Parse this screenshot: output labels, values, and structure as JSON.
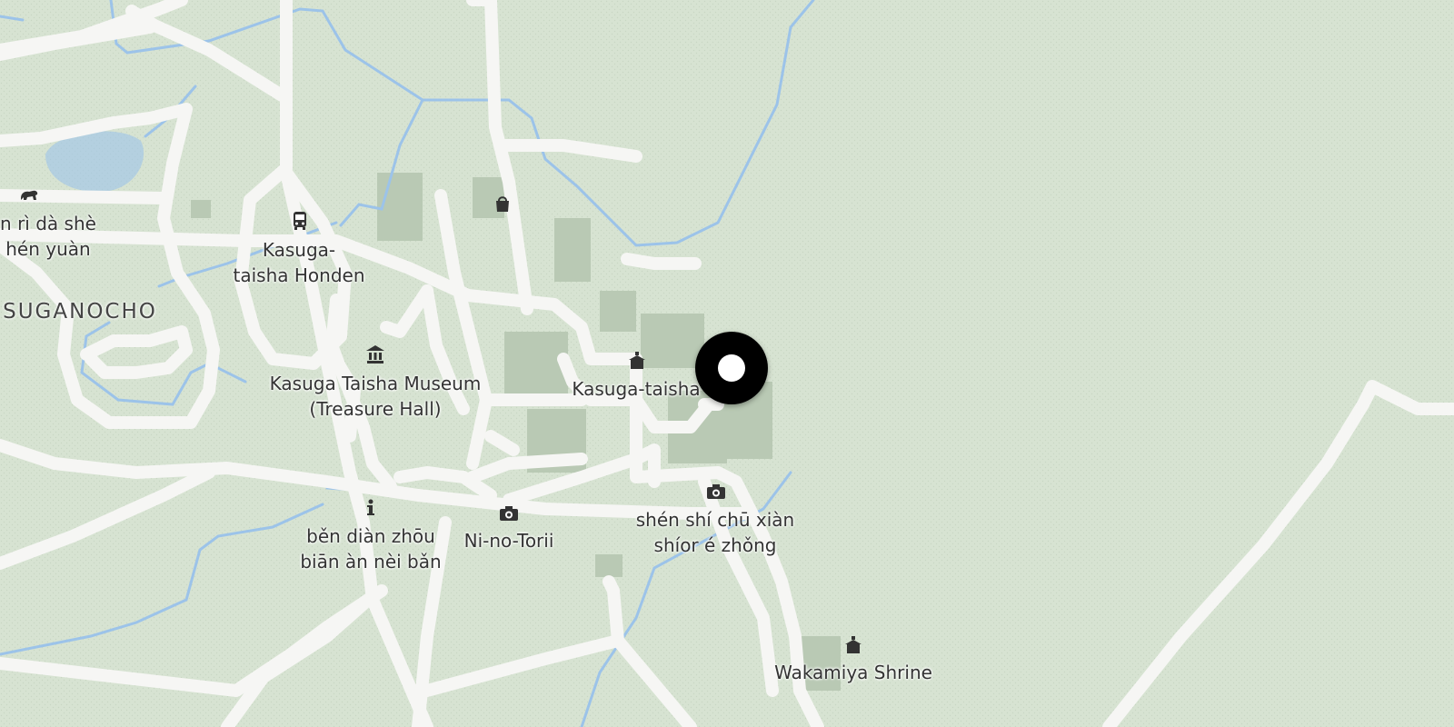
{
  "map": {
    "colors": {
      "land": "#d7e3d2",
      "road": "#f6f6f4",
      "water": "#9cc3e9",
      "building": "#b9c9b4",
      "label_text": "#333333",
      "pin": "#000000"
    },
    "district_label": "SUGANOCHO",
    "labels": {
      "park_partial": "n rì dà shè\nhén yuàn",
      "kasuga_taisha_honden": "Kasuga-\ntaisha Honden",
      "museum": "Kasuga Taisha Museum\n(Treasure Hall)",
      "kasuga_taisha": "Kasuga-taisha",
      "info_board": "běn diàn zhōu\nbiān àn nèi bǎn",
      "ni_no_torii": "Ni-no-Torii",
      "shen_shi": "shén shí chū xiàn\nshíor é zhǒng",
      "wakamiya": "Wakamiya Shrine"
    },
    "icons": {
      "zoo": "lion-icon",
      "bus": "bus-icon",
      "shop": "shopping-bag-icon",
      "museum": "museum-icon",
      "shrine": "shrine-icon",
      "info": "info-icon",
      "camera": "camera-icon"
    },
    "selected_marker": "location-pin-icon"
  }
}
